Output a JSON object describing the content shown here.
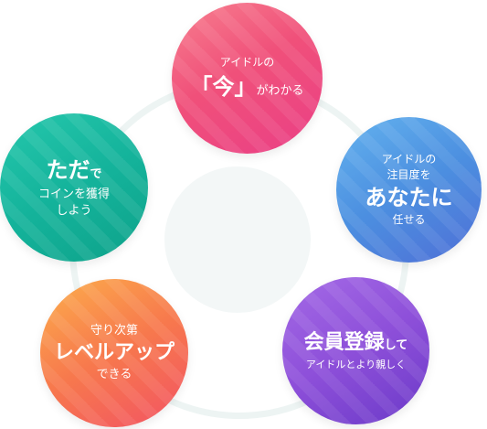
{
  "diagram": {
    "nodes": {
      "top": {
        "line1": "アイドルの",
        "emph": "「今」",
        "rest": "がわかる"
      },
      "right": {
        "line1": "アイドルの",
        "line2": "注目度を",
        "emph": "あなたに",
        "line3": "任せる"
      },
      "left": {
        "emph": "ただ",
        "rest": "で",
        "line2": "コインを獲得",
        "line3": "しよう"
      },
      "bottom_left": {
        "line1": "守り次第",
        "emph": "レベルアップ",
        "line3": "できる"
      },
      "bottom_right": {
        "emph": "会員登録",
        "rest": "して",
        "line2": "アイドルとより親しく"
      }
    },
    "colors": {
      "top": "#ef4f7c",
      "right": "#4c8fe0",
      "left": "#14b39b",
      "bottom_left": "#f7784d",
      "bottom_right": "#8d4fd9",
      "ring": "#edf4f3"
    }
  }
}
